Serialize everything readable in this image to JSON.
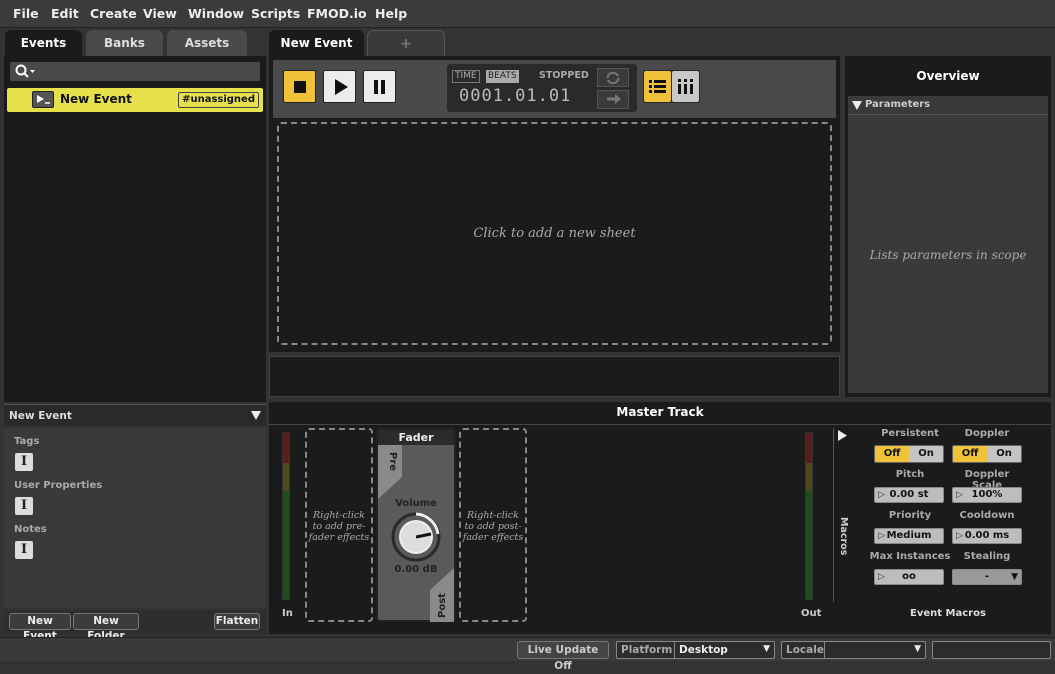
{
  "menu": {
    "items": [
      "File",
      "Edit",
      "Create",
      "View",
      "Window",
      "Scripts",
      "FMOD.io",
      "Help"
    ]
  },
  "browser": {
    "tabs": [
      "Events",
      "Banks",
      "Assets"
    ],
    "event_item": {
      "name": "New Event",
      "tag": "#unassigned"
    },
    "properties_header": "New Event",
    "sections": [
      "Tags",
      "User Properties",
      "Notes"
    ],
    "buttons": {
      "new_event": "New Event",
      "new_folder": "New Folder",
      "flatten": "Flatten"
    }
  },
  "editor": {
    "tabs": [
      "New Event",
      "+"
    ],
    "transport": {
      "time_label": "TIME",
      "beats_label": "BEATS",
      "state": "STOPPED",
      "position": "0001.01.01"
    },
    "sheet_hint": "Click to add a new sheet"
  },
  "overview": {
    "title": "Overview",
    "parameters_label": "Parameters",
    "hint": "Lists parameters in scope"
  },
  "master_track": {
    "title": "Master Track",
    "in_label": "In",
    "out_label": "Out",
    "pre_hint": "Right-click to add pre-fader effects",
    "post_hint": "Right-click to add post-fader effects",
    "fader": {
      "title": "Fader",
      "pre": "Pre",
      "post": "Post",
      "volume_label": "Volume",
      "volume_value": "0.00 dB"
    },
    "macros_label": "Macros",
    "macros": {
      "persistent": {
        "label": "Persistent",
        "off": "Off",
        "on": "On",
        "selected": "Off"
      },
      "doppler": {
        "label": "Doppler",
        "off": "Off",
        "on": "On",
        "selected": "Off"
      },
      "pitch": {
        "label": "Pitch",
        "value": "0.00 st"
      },
      "doppler_scale": {
        "label": "Doppler Scale",
        "value": "100%"
      },
      "priority": {
        "label": "Priority",
        "value": "Medium"
      },
      "cooldown": {
        "label": "Cooldown",
        "value": "0.00 ms"
      },
      "max_instances": {
        "label": "Max Instances",
        "value": "oo"
      },
      "stealing": {
        "label": "Stealing",
        "value": "-"
      },
      "footer": "Event Macros"
    }
  },
  "statusbar": {
    "live_update": "Live Update Off",
    "platform_label": "Platform",
    "platform_value": "Desktop",
    "locale_label": "Locale",
    "locale_value": ""
  },
  "colors": {
    "accent": "#f0c23a",
    "event_highlight": "#e6e14a"
  }
}
